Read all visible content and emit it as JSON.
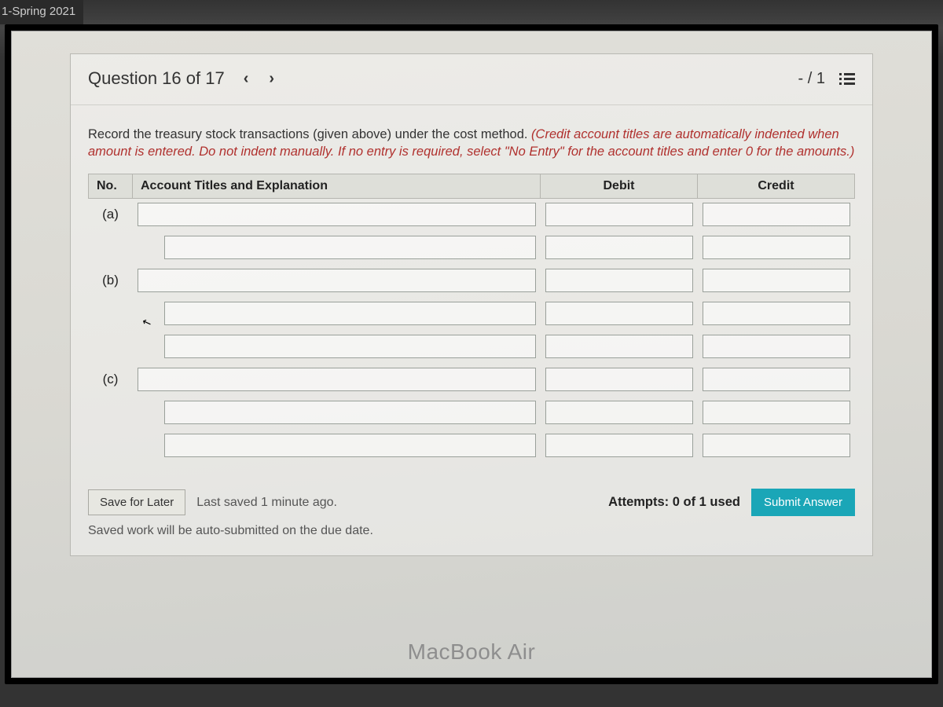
{
  "tab": {
    "title": "1-Spring 2021"
  },
  "header": {
    "question_label": "Question 16 of 17",
    "score": "- / 1"
  },
  "instructions": {
    "plain": "Record the treasury stock transactions (given above) under the cost method. ",
    "emph": "(Credit account titles are automatically indented when amount is entered. Do not indent manually. If no entry is required, select \"No Entry\" for the account titles and enter 0 for the amounts.)"
  },
  "table": {
    "headers": {
      "no": "No.",
      "acct": "Account Titles and Explanation",
      "debit": "Debit",
      "credit": "Credit"
    },
    "rows": [
      {
        "no": "(a)",
        "indent": false
      },
      {
        "no": "",
        "indent": true
      },
      {
        "no": "(b)",
        "indent": false
      },
      {
        "no": "",
        "indent": true
      },
      {
        "no": "",
        "indent": true
      },
      {
        "no": "(c)",
        "indent": false
      },
      {
        "no": "",
        "indent": true
      },
      {
        "no": "",
        "indent": true
      }
    ]
  },
  "footer": {
    "save_label": "Save for Later",
    "last_saved": "Last saved 1 minute ago.",
    "attempts": "Attempts: 0 of 1 used",
    "submit_label": "Submit Answer",
    "autosave_note": "Saved work will be auto-submitted on the due date."
  },
  "device": {
    "label": "MacBook Air"
  }
}
